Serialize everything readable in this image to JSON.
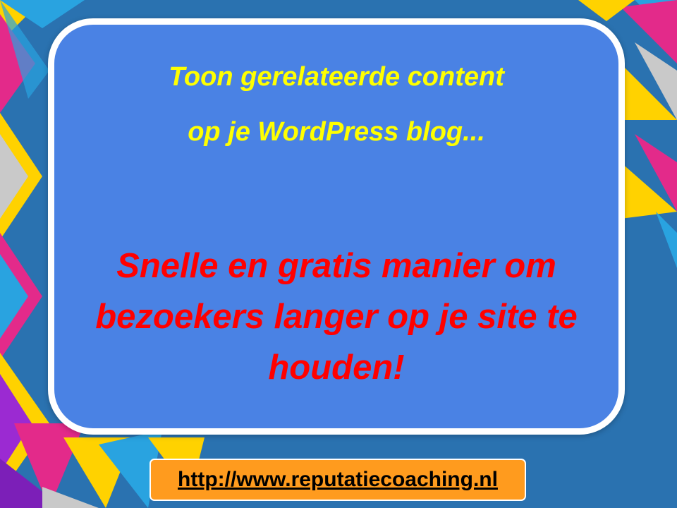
{
  "slide": {
    "headline_line1": "Toon gerelateerde content",
    "headline_line2": "op je WordPress blog...",
    "tagline": "Snelle en gratis manier om bezoekers langer op je site te houden!",
    "url": "http://www.reputatiecoaching.nl"
  },
  "colors": {
    "background": "#2a72b0",
    "card": "#4a82e4",
    "headline": "#ffff00",
    "tagline": "#ff0000",
    "url_box": "#ff9b1e"
  }
}
